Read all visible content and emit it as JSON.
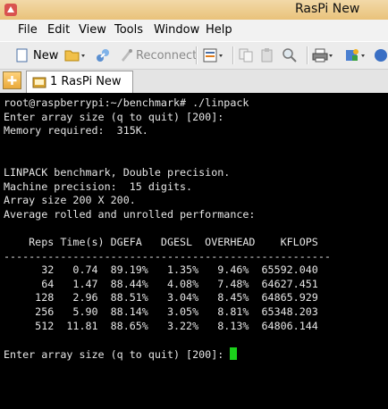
{
  "window": {
    "title": "RasPi New"
  },
  "menu": [
    "File",
    "Edit",
    "View",
    "Tools",
    "Window",
    "Help"
  ],
  "toolbar": {
    "new_label": "New",
    "reconnect_label": "Reconnect",
    "icons": [
      "new-icon",
      "open-folder-icon",
      "connect-icon",
      "reconnect-icon",
      "settings-icon",
      "copy-icon",
      "paste-icon",
      "find-icon",
      "print-icon",
      "transfer-icon",
      "help-icon"
    ]
  },
  "tabs": {
    "active_label": "1 RasPi New"
  },
  "terminal": {
    "lines": [
      "root@raspberrypi:~/benchmark# ./linpack",
      "Enter array size (q to quit) [200]:",
      "Memory required:  315K.",
      "",
      "",
      "LINPACK benchmark, Double precision.",
      "Machine precision:  15 digits.",
      "Array size 200 X 200.",
      "Average rolled and unrolled performance:",
      "",
      "    Reps Time(s) DGEFA   DGESL  OVERHEAD    KFLOPS",
      "----------------------------------------------------",
      "      32   0.74  89.19%   1.35%   9.46%  65592.040",
      "      64   1.47  88.44%   4.08%   7.48%  64627.451",
      "     128   2.96  88.51%   3.04%   8.45%  64865.929",
      "     256   5.90  88.14%   3.05%   8.81%  65348.203",
      "     512  11.81  88.65%   3.22%   8.13%  64806.144",
      "",
      "Enter array size (q to quit) [200]: "
    ],
    "cursor_color": "#1bd11b"
  }
}
